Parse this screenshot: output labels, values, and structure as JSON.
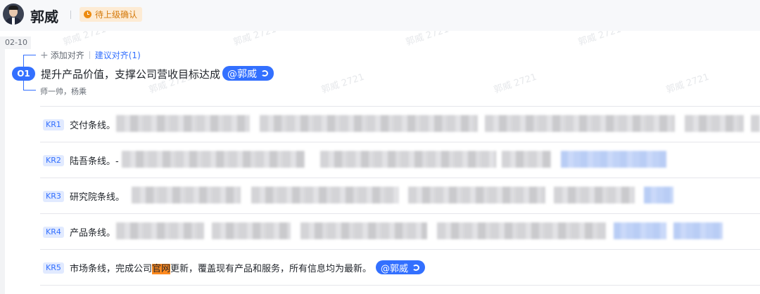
{
  "header": {
    "owner_name": "郭威",
    "status": "待上级确认"
  },
  "period_label": "02-10",
  "objective": {
    "badge": "O1",
    "add_alignment": "添加对齐",
    "suggest_alignment": "建议对齐(1)",
    "title": "提升产品价值，支撑公司营收目标达成",
    "mention": "@郭威",
    "collaborators": "师一帅，杨乘"
  },
  "key_results": [
    {
      "badge": "KR1",
      "text": "交付条线。"
    },
    {
      "badge": "KR2",
      "text": "陆吾条线。-"
    },
    {
      "badge": "KR3",
      "text": "研究院条线。"
    },
    {
      "badge": "KR4",
      "text": "产品条线。"
    },
    {
      "badge": "KR5",
      "text_before": "市场条线，完成公司",
      "highlight": "官网",
      "text_after": "更新，覆盖现有产品和服务，所有信息均为最新。",
      "mention": "@郭威"
    }
  ],
  "watermark": "郭威 2721",
  "colors": {
    "accent": "#3370ff",
    "status": "#ed8b10",
    "highlight": "#ff8a1f"
  },
  "icons": {
    "avatar": "avatar",
    "status": "clock-icon",
    "add": "plus-icon",
    "mention_link": "link-icon"
  }
}
